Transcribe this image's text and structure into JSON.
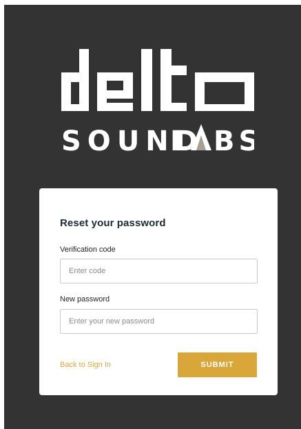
{
  "brand": {
    "logo_wordmark": "delta",
    "logo_subtitle": "SOUND LABS",
    "accent_color": "#a89e93"
  },
  "reset_form": {
    "title": "Reset your password",
    "verification_code": {
      "label": "Verification code",
      "placeholder": "Enter code",
      "value": ""
    },
    "new_password": {
      "label": "New password",
      "placeholder": "Enter your new password",
      "value": ""
    },
    "back_link_label": "Back to Sign In",
    "submit_label": "SUBMIT"
  },
  "colors": {
    "background": "#333333",
    "button": "#d9a63a",
    "link": "#d9a63a"
  }
}
